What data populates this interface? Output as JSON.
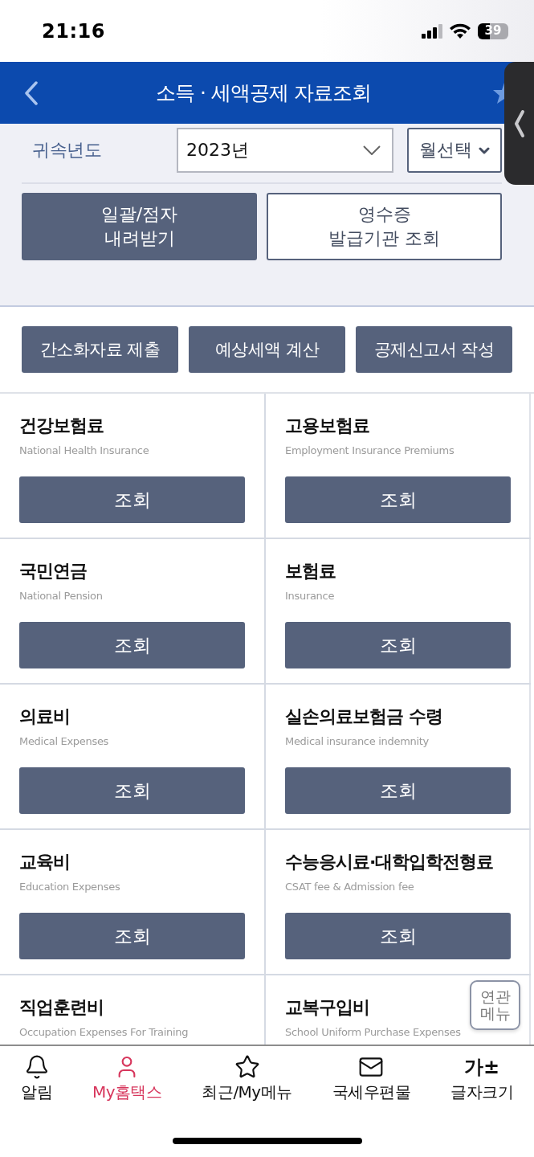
{
  "status_bar": {
    "time": "21:16",
    "battery": "39"
  },
  "header": {
    "title": "소득 · 세액공제 자료조회"
  },
  "filter": {
    "year_label": "귀속년도",
    "year_select": {
      "value": "2023년"
    },
    "month_button": "월선택"
  },
  "download_buttons": [
    {
      "label": "일괄/점자\n내려받기",
      "kind": "filled"
    },
    {
      "label": "영수증\n발급기관 조회",
      "kind": "outline"
    }
  ],
  "action_buttons": [
    "간소화자료 제출",
    "예상세액 계산",
    "공제신고서 작성"
  ],
  "categories": [
    {
      "title": "건강보험료",
      "subtitle": "National Health Insurance",
      "button": "조회"
    },
    {
      "title": "고용보험료",
      "subtitle": "Employment Insurance Premiums",
      "button": "조회"
    },
    {
      "title": "국민연금",
      "subtitle": "National Pension",
      "button": "조회"
    },
    {
      "title": "보험료",
      "subtitle": "Insurance",
      "button": "조회"
    },
    {
      "title": "의료비",
      "subtitle": "Medical Expenses",
      "button": "조회"
    },
    {
      "title": "실손의료보험금 수령",
      "subtitle": "Medical insurance indemnity",
      "button": "조회"
    },
    {
      "title": "교육비",
      "subtitle": "Education Expenses",
      "button": "조회"
    },
    {
      "title": "수능응시료·대학입학전형료",
      "subtitle": "CSAT fee & Admission fee",
      "button": "조회"
    },
    {
      "title": "직업훈련비",
      "subtitle": "Occupation Expenses For Training"
    },
    {
      "title": "교복구입비",
      "subtitle": "School Uniform Purchase Expenses"
    }
  ],
  "related_menu": {
    "label": "연관\n메뉴"
  },
  "bottom_nav": [
    {
      "label": "알림",
      "selected": false
    },
    {
      "label": "My홈택스",
      "selected": true
    },
    {
      "label": "최근/My메뉴",
      "selected": false
    },
    {
      "label": "국세우편물",
      "selected": false
    },
    {
      "label": "글자크기",
      "glyph": "가±",
      "selected": false
    }
  ]
}
